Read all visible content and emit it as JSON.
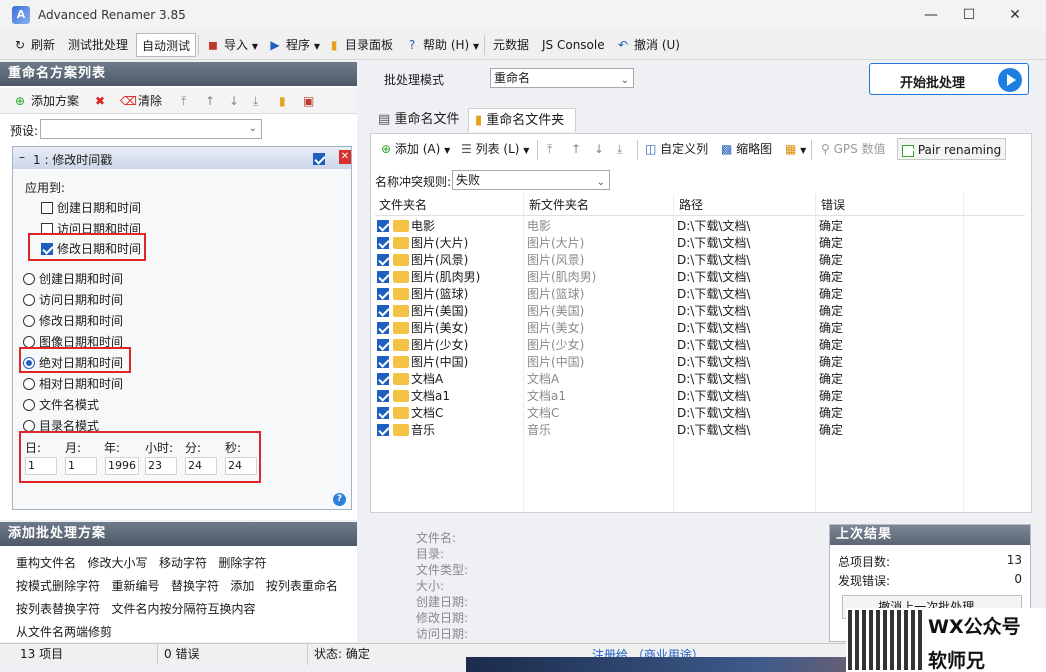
{
  "window": {
    "title": "Advanced Renamer 3.85"
  },
  "toolbar": {
    "refresh": "刷新",
    "test_batch": "测试批处理",
    "auto_test": "自动测试",
    "import": "导入",
    "program": "程序",
    "dir_panel": "目录面板",
    "help": "帮助 (H)",
    "metadata": "元数据",
    "js_console": "JS Console",
    "undo": "撤消 (U)"
  },
  "method_list": {
    "title": "重命名方案列表",
    "add_method": "添加方案",
    "clear": "清除",
    "preset_label": "预设:",
    "preset_value": ""
  },
  "method": {
    "title": "1 : 修改时间戳",
    "apply_to_label": "应用到:",
    "apply_checks": [
      {
        "label": "创建日期和时间",
        "checked": false
      },
      {
        "label": "访问日期和时间",
        "checked": false
      },
      {
        "label": "修改日期和时间",
        "checked": true
      }
    ],
    "sources": [
      {
        "label": "创建日期和时间",
        "selected": false
      },
      {
        "label": "访问日期和时间",
        "selected": false
      },
      {
        "label": "修改日期和时间",
        "selected": false
      },
      {
        "label": "图像日期和时间",
        "selected": false
      },
      {
        "label": "绝对日期和时间",
        "selected": true
      },
      {
        "label": "相对日期和时间",
        "selected": false
      },
      {
        "label": "文件名模式",
        "selected": false
      },
      {
        "label": "目录名模式",
        "selected": false
      }
    ],
    "fields": [
      {
        "label": "日:",
        "value": "1"
      },
      {
        "label": "月:",
        "value": "1"
      },
      {
        "label": "年:",
        "value": "1996"
      },
      {
        "label": "小时:",
        "value": "23"
      },
      {
        "label": "分:",
        "value": "24"
      },
      {
        "label": "秒:",
        "value": "24"
      }
    ]
  },
  "add_methods": {
    "title": "添加批处理方案",
    "rows": [
      [
        "重构文件名",
        "修改大小写",
        "移动字符",
        "删除字符"
      ],
      [
        "按模式删除字符",
        "重新编号",
        "替换字符",
        "添加",
        "按列表重命名"
      ],
      [
        "按列表替换字符",
        "文件名内按分隔符互换内容"
      ],
      [
        "从文件名两端修剪"
      ]
    ]
  },
  "batch": {
    "mode_label": "批处理模式",
    "mode_value": "重命名",
    "start_label": "开始批处理"
  },
  "tabs": [
    {
      "label": "重命名文件",
      "active": false
    },
    {
      "label": "重命名文件夹",
      "active": true
    }
  ],
  "list_toolbar": {
    "add": "添加 (A)",
    "list": "列表 (L)",
    "custom_cols": "自定义列",
    "thumbnail": "缩略图",
    "gps": "GPS 数值",
    "pair": "Pair renaming"
  },
  "conflict": {
    "label": "名称冲突规则:",
    "value": "失败"
  },
  "grid": {
    "columns": [
      "文件夹名",
      "新文件夹名",
      "路径",
      "错误"
    ],
    "rows": [
      {
        "name": "电影",
        "new": "电影",
        "path": "D:\\下载\\文档\\",
        "err": "确定"
      },
      {
        "name": "图片(大片)",
        "new": "图片(大片)",
        "path": "D:\\下载\\文档\\",
        "err": "确定"
      },
      {
        "name": "图片(风景)",
        "new": "图片(风景)",
        "path": "D:\\下载\\文档\\",
        "err": "确定"
      },
      {
        "name": "图片(肌肉男)",
        "new": "图片(肌肉男)",
        "path": "D:\\下载\\文档\\",
        "err": "确定"
      },
      {
        "name": "图片(篮球)",
        "new": "图片(篮球)",
        "path": "D:\\下载\\文档\\",
        "err": "确定"
      },
      {
        "name": "图片(美国)",
        "new": "图片(美国)",
        "path": "D:\\下载\\文档\\",
        "err": "确定"
      },
      {
        "name": "图片(美女)",
        "new": "图片(美女)",
        "path": "D:\\下载\\文档\\",
        "err": "确定"
      },
      {
        "name": "图片(少女)",
        "new": "图片(少女)",
        "path": "D:\\下载\\文档\\",
        "err": "确定"
      },
      {
        "name": "图片(中国)",
        "new": "图片(中国)",
        "path": "D:\\下载\\文档\\",
        "err": "确定"
      },
      {
        "name": "文档A",
        "new": "文档A",
        "path": "D:\\下载\\文档\\",
        "err": "确定"
      },
      {
        "name": "文档a1",
        "new": "文档a1",
        "path": "D:\\下载\\文档\\",
        "err": "确定"
      },
      {
        "name": "文档C",
        "new": "文档C",
        "path": "D:\\下载\\文档\\",
        "err": "确定"
      },
      {
        "name": "音乐",
        "new": "音乐",
        "path": "D:\\下载\\文档\\",
        "err": "确定"
      }
    ]
  },
  "info": [
    "文件名:",
    "目录:",
    "文件类型:",
    "大小:",
    "创建日期:",
    "修改日期:",
    "访问日期:"
  ],
  "last_result": {
    "title": "上次结果",
    "total_label": "总项目数:",
    "total": "13",
    "errors_label": "发现错误:",
    "errors": "0",
    "undo_label": "撤消上一次批处理..."
  },
  "status": {
    "items": "13 项目",
    "errors": "0 错误",
    "state": "状态: 确定",
    "register": "注册给 （商业用途）"
  },
  "watermark": {
    "line1": "WX公众号",
    "line2": "软师兄"
  }
}
